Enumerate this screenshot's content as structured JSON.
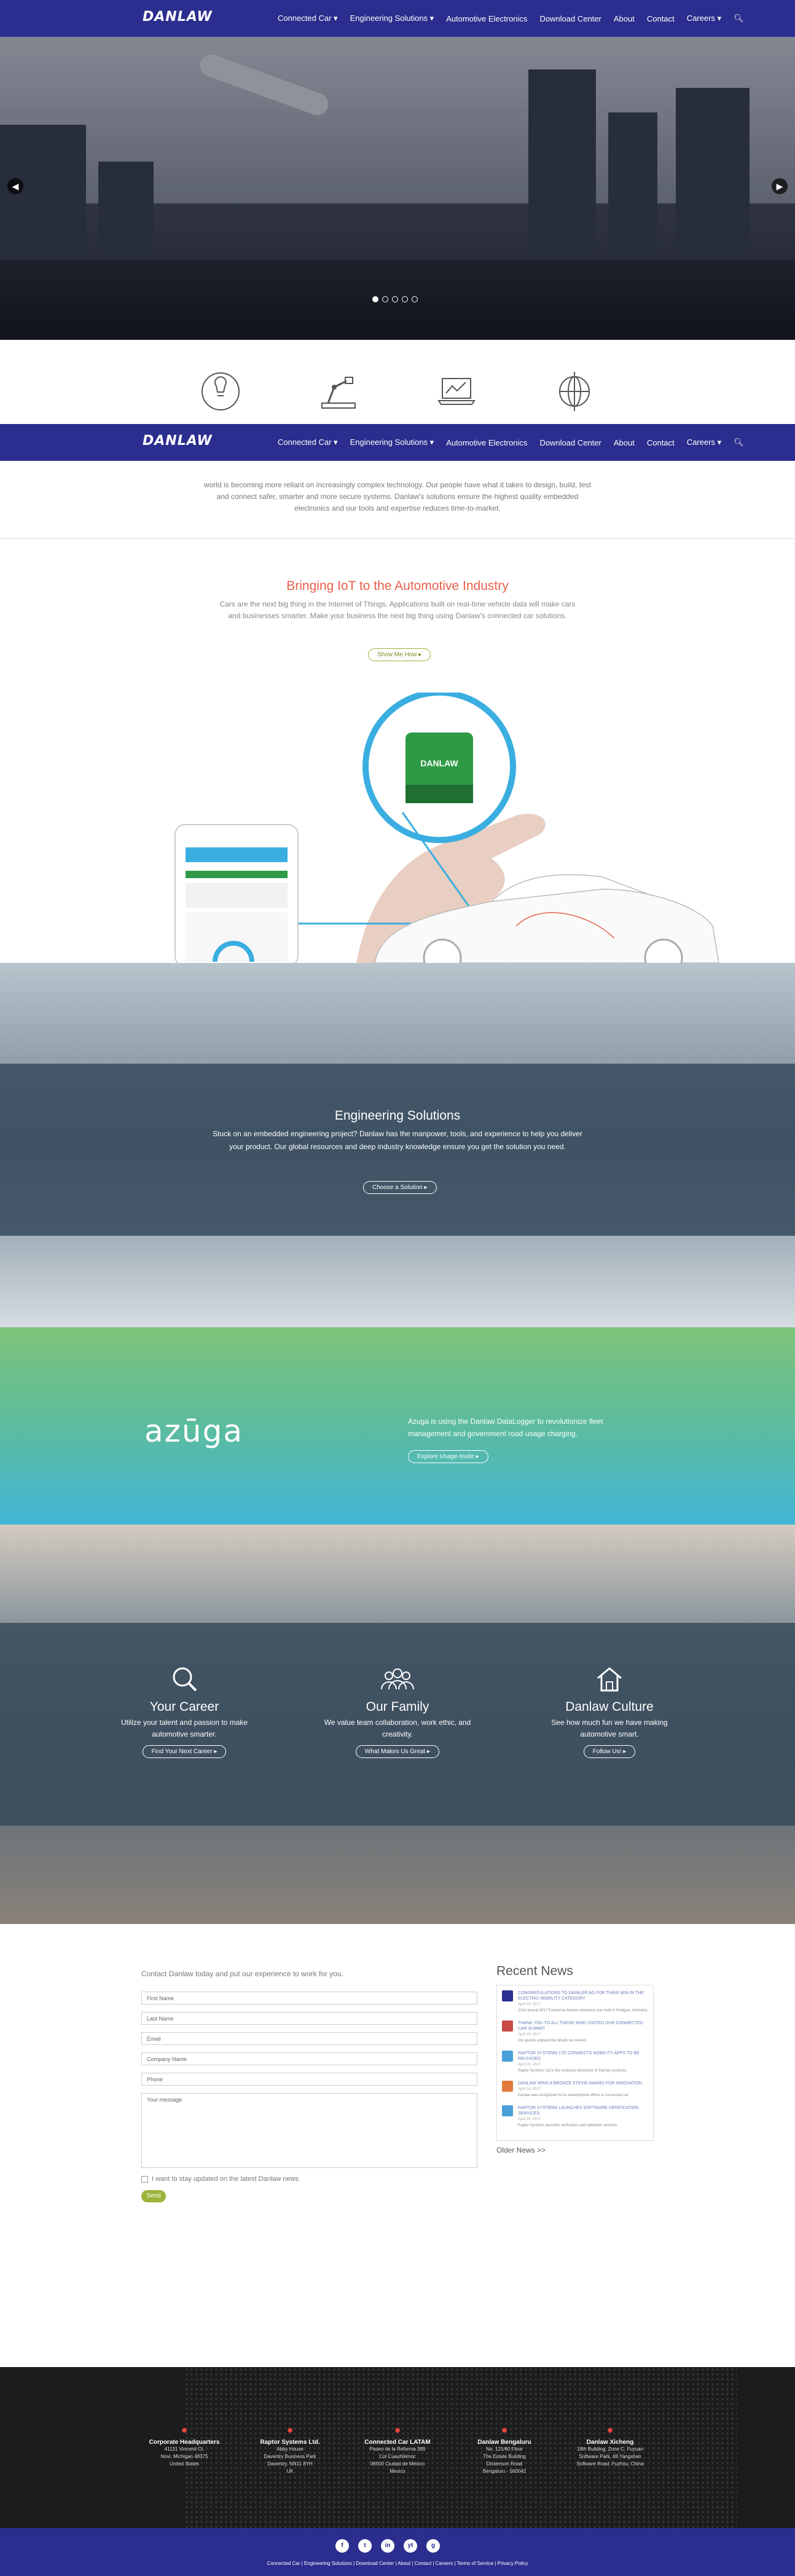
{
  "nav": {
    "logo": "DANLAW",
    "items": [
      "Connected Car ▾",
      "Engineering Solutions ▾",
      "Automotive Electronics",
      "Download Center",
      "About",
      "Contact",
      "Careers ▾"
    ],
    "search_icon": "search-icon"
  },
  "intro": {
    "text": "world is becoming more reliant on increasingly complex technology. Our people have what it takes to design, build, test and connect safer, smarter and more secure systems. Danlaw's solutions ensure the highest quality embedded electronics and our tools and expertise reduces time-to-market."
  },
  "iot": {
    "title": "Bringing IoT to the Automotive Industry",
    "text": "Cars are the next big thing in the Internet of Things. Applications built on real-time vehicle data will make cars and businesses smarter. Make your business the next big thing using Danlaw's connected car solutions.",
    "button": "Show Me How ▸",
    "device_label": "DANLAW"
  },
  "engineering": {
    "title": "Engineering Solutions",
    "text": "Stuck on an embedded engineering project? Danlaw has the manpower, tools, and experience to help you deliver your product. Our global resources and deep industry knowledge ensure you get the solution you need.",
    "button": "Choose a Solution ▸"
  },
  "azuga": {
    "logo": "azūga",
    "text": "Azuga is using the Danlaw DataLogger to revolutionize fleet management and government road usage charging.",
    "button": "Explore Usage-Insite ▸"
  },
  "careers": [
    {
      "title": "Your Career",
      "text": "Utilize your talent and passion to make automotive smarter.",
      "button": "Find Your Next Career ▸"
    },
    {
      "title": "Our Family",
      "text": "We value team collaboration, work ethic, and creativity.",
      "button": "What Makes Us Great ▸"
    },
    {
      "title": "Danlaw Culture",
      "text": "See how much fun we have making automotive smart.",
      "button": "Follow Us! ▸"
    }
  ],
  "contact": {
    "title": "Contact Danlaw today and put our experience to work for you.",
    "fields": [
      "First Name",
      "Last Name",
      "Email",
      "Company Name",
      "Phone"
    ],
    "message": "Your message",
    "checkbox": "I want to stay updated on the latest Danlaw news",
    "send": "Send"
  },
  "news": {
    "title": "Recent News",
    "items": [
      {
        "title": "Congratulations to Daimler AG for their win in the Electric Mobility category",
        "date": "April 24, 2017",
        "excerpt": "22nd annual 2017 Enterprise Awards ceremony was held in Stuttgart, Germany.",
        "color": "#2b2e8e"
      },
      {
        "title": "Thank you to all those who visited our connected car summit",
        "date": "April 24, 2017",
        "excerpt": "Our guests enjoyed the details we shared.",
        "color": "#c84a44"
      },
      {
        "title": "Raptor Systems Ltd connects mobility apps to be released",
        "date": "April 24, 2017",
        "excerpt": "Raptor Systems Ltd is the exclusive distributor of Danlaw products.",
        "color": "#4aa0d8"
      },
      {
        "title": "Danlaw wins a Bronze Stevie award for innovation",
        "date": "April 24, 2017",
        "excerpt": "Danlaw was recognized for its development efforts in connected car.",
        "color": "#e07a3a"
      },
      {
        "title": "Raptor Systems launches software verification services",
        "date": "April 24, 2017",
        "excerpt": "Raptor Systems launches verification and validation services.",
        "color": "#4aa0d8"
      }
    ],
    "older": "Older News >>"
  },
  "offices": [
    {
      "name": "Corporate Headquarters",
      "lines": [
        "41131 Vincenti Ct.",
        "Novi, Michigan 48375",
        "United States"
      ]
    },
    {
      "name": "Raptor Systems Ltd.",
      "lines": [
        "Abby House",
        "Daventry Business Park",
        "Daventry, NN11 8YH",
        "UK"
      ]
    },
    {
      "name": "Connected Car LATAM",
      "lines": [
        "Paseo de la Reforma 389",
        "Col Cuauhtémoc",
        "06500 Ciudad de México",
        "Mexico"
      ]
    },
    {
      "name": "Danlaw Bengaluru",
      "lines": [
        "No. 121/60 Floor",
        "The Estate Building",
        "Dickenson Road",
        "Bengaluru - 560042"
      ]
    },
    {
      "name": "Danlaw Xicheng",
      "lines": [
        "19th Building, Zone C, Fuyuan",
        "Software Park, #8 Yangshan",
        "Software Road, Fuzhou, China"
      ]
    }
  ],
  "social": [
    "f",
    "t",
    "in",
    "yt",
    "g"
  ],
  "footer_links": "Connected Car  |  Engineering Solutions  |  Download Center  |  About  |  Contact  |  Careers  |  Terms of Service  |  Privacy Policy"
}
